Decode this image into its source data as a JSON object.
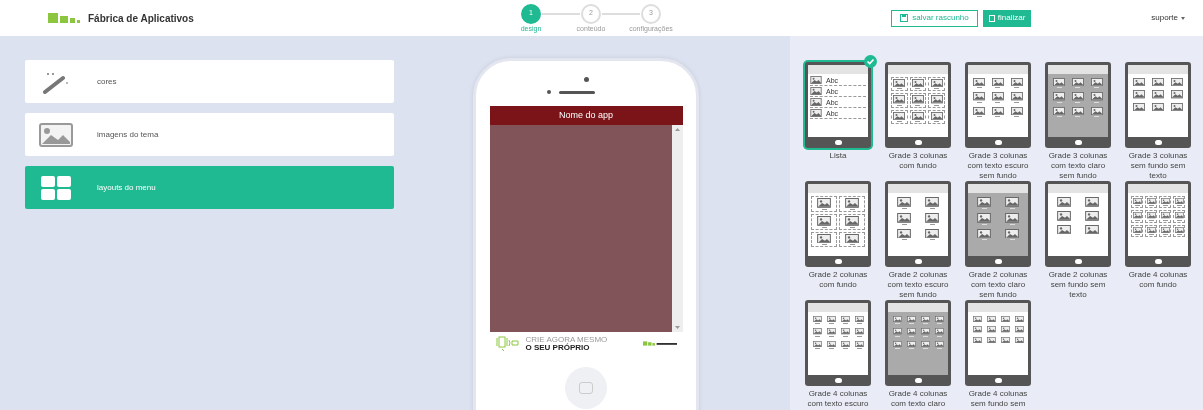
{
  "header": {
    "brand": "Fábrica de Aplicativos",
    "steps": [
      {
        "number": "1",
        "label": "design",
        "selected": true
      },
      {
        "number": "2",
        "label": "conteúdo",
        "selected": false
      },
      {
        "number": "3",
        "label": "configurações",
        "selected": false
      }
    ],
    "save_button": "salvar rascunho",
    "finish_button": "finalizar",
    "user_menu": "suporte"
  },
  "sidebar": {
    "items": [
      {
        "kind": "wand",
        "label": "cores",
        "selected": false
      },
      {
        "kind": "image",
        "label": "imagens do tema",
        "selected": false
      },
      {
        "kind": "grid",
        "label": "layouts do menu",
        "selected": true
      }
    ]
  },
  "preview": {
    "app_title": "Nome do app",
    "banner_line_1": "CRIE AGORA MESMO",
    "banner_line_2": "O SEU PRÓPRIO"
  },
  "layouts": [
    {
      "kind": "list",
      "label": "Lista",
      "item_texts": [
        "Abc",
        "Abc",
        "Abc",
        "Abc"
      ],
      "selected": true
    },
    {
      "kind": "grid3-boxed",
      "label": "Grade 3 colunas com fundo",
      "selected": false
    },
    {
      "kind": "grid3-dark",
      "label": "Grade 3 colunas com texto escuro sem fundo",
      "selected": false
    },
    {
      "kind": "grid3-light",
      "label": "Grade 3 colunas com texto claro sem fundo",
      "selected": false
    },
    {
      "kind": "grid3-plain",
      "label": "Grade 3 colunas sem fundo sem texto",
      "selected": false
    },
    {
      "kind": "grid2-boxed",
      "label": "Grade 2 colunas com fundo",
      "selected": false
    },
    {
      "kind": "grid2-dark",
      "label": "Grade 2 colunas com texto escuro sem fundo",
      "selected": false
    },
    {
      "kind": "grid2-light",
      "label": "Grade 2 colunas com texto claro sem fundo",
      "selected": false
    },
    {
      "kind": "grid2-plain",
      "label": "Grade 2 colunas sem fundo sem texto",
      "selected": false
    },
    {
      "kind": "grid4-boxed",
      "label": "Grade 4 colunas com fundo",
      "selected": false
    },
    {
      "kind": "grid4-dark",
      "label": "Grade 4 colunas com texto escuro",
      "selected": false
    },
    {
      "kind": "grid4-light",
      "label": "Grade 4 colunas com texto claro",
      "selected": false
    },
    {
      "kind": "grid4-plain",
      "label": "Grade 4 colunas sem fundo sem",
      "selected": false
    }
  ]
}
